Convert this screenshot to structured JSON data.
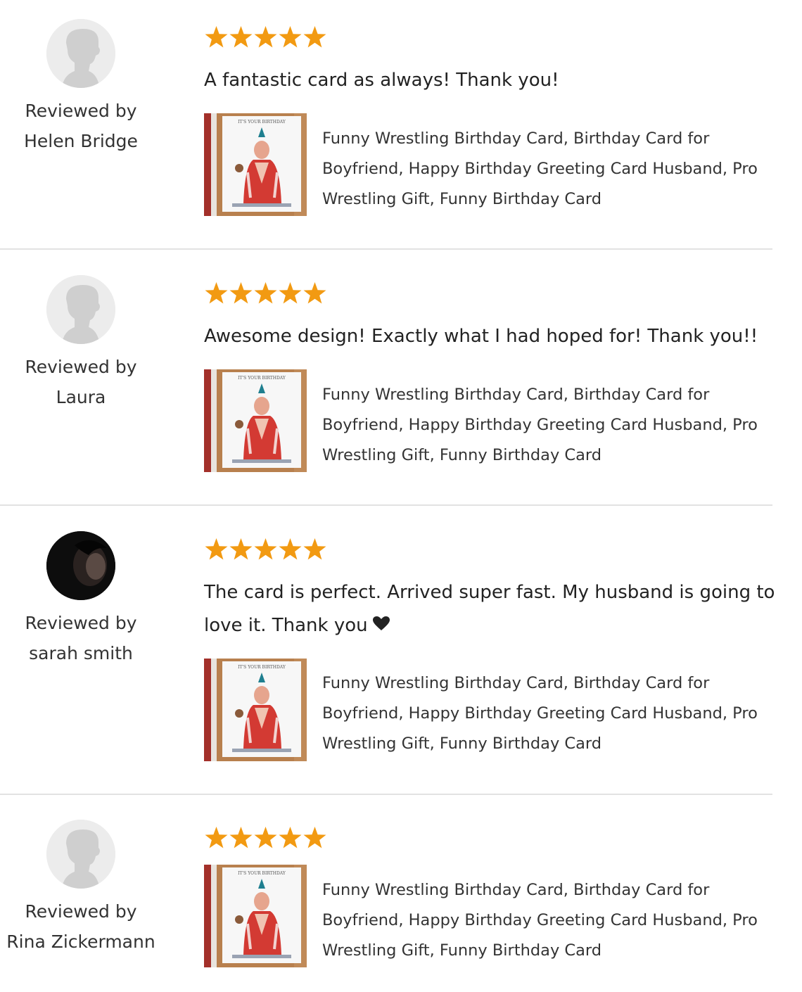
{
  "reviews": [
    {
      "reviewed_by_label": "Reviewed by",
      "reviewer_name": "Helen Bridge",
      "avatar": "default-avatar",
      "rating": 5,
      "text": "A fantastic card as always! Thank you!",
      "product_title": "Funny Wrestling Birthday Card, Birthday Card for Boyfriend, Happy Birthday Greeting Card Husband, Pro Wrestling Gift, Funny Birthday Card"
    },
    {
      "reviewed_by_label": "Reviewed by",
      "reviewer_name": "Laura",
      "avatar": "default-avatar",
      "rating": 5,
      "text": "Awesome design! Exactly what I had hoped for! Thank you!!",
      "product_title": "Funny Wrestling Birthday Card, Birthday Card for Boyfriend, Happy Birthday Greeting Card Husband, Pro Wrestling Gift, Funny Birthday Card"
    },
    {
      "reviewed_by_label": "Reviewed by",
      "reviewer_name": "sarah smith",
      "avatar": "photo-avatar",
      "rating": 5,
      "text": "The card is perfect. Arrived super fast. My husband is going to love it. Thank you",
      "text_icon": "heart-icon",
      "product_title": "Funny Wrestling Birthday Card, Birthday Card for Boyfriend, Happy Birthday Greeting Card Husband, Pro Wrestling Gift, Funny Birthday Card"
    },
    {
      "reviewed_by_label": "Reviewed by",
      "reviewer_name": "Rina Zickermann",
      "avatar": "default-avatar",
      "rating": 5,
      "text": "",
      "product_title": "Funny Wrestling Birthday Card, Birthday Card for Boyfriend, Happy Birthday Greeting Card Husband, Pro Wrestling Gift, Funny Birthday Card"
    }
  ],
  "thumbnail_card_text": "IT'S YOUR BIRTHDAY",
  "colors": {
    "star": "#f29a12",
    "divider": "#e2e2e2",
    "avatar_bg": "#ececec",
    "avatar_silhouette": "#cfcfcf"
  }
}
